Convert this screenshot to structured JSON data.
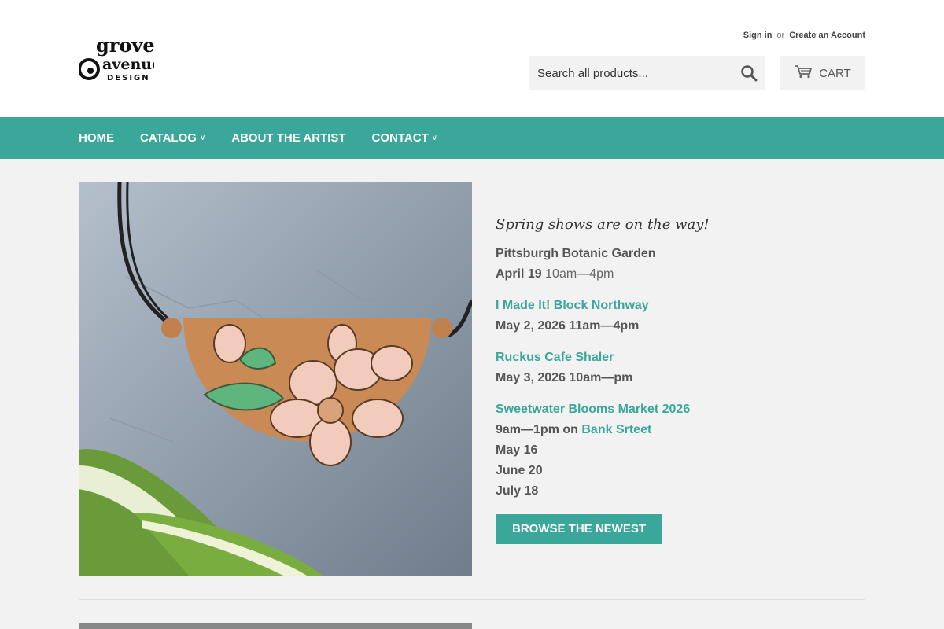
{
  "brand": {
    "logo_line1": "grove",
    "logo_line2": "avenue",
    "logo_line3": "DESIGN",
    "accent_color": "#3aa79a"
  },
  "account": {
    "sign_in": "Sign in",
    "or": "or",
    "create_account": "Create an Account"
  },
  "search": {
    "placeholder": "Search all products...",
    "icon": "search-icon"
  },
  "cart": {
    "label": "CART",
    "icon": "cart-icon"
  },
  "nav": {
    "items": [
      {
        "label": "HOME",
        "dropdown": false
      },
      {
        "label": "CATALOG",
        "dropdown": true
      },
      {
        "label": "ABOUT THE ARTIST",
        "dropdown": false
      },
      {
        "label": "CONTACT",
        "dropdown": true
      }
    ]
  },
  "hero": {
    "heading": "Spring shows are on the way!",
    "events": [
      {
        "name": "Pittsburgh Botanic Garden",
        "date": "April 19",
        "time": "10am—4pm"
      },
      {
        "name": "I Made It! Block Northway",
        "datetime": "May 2, 2026 11am—4pm"
      },
      {
        "name": "Ruckus Cafe Shaler",
        "datetime": "May 3, 2026 10am—pm"
      },
      {
        "name": "Sweetwater Blooms Market 2026",
        "time_prefix": "9am—1pm on",
        "location": "Bank Srteet",
        "dates": [
          "May 16",
          "June 20",
          "July 18"
        ]
      }
    ],
    "button_label": "BROWSE THE NEWEST"
  }
}
